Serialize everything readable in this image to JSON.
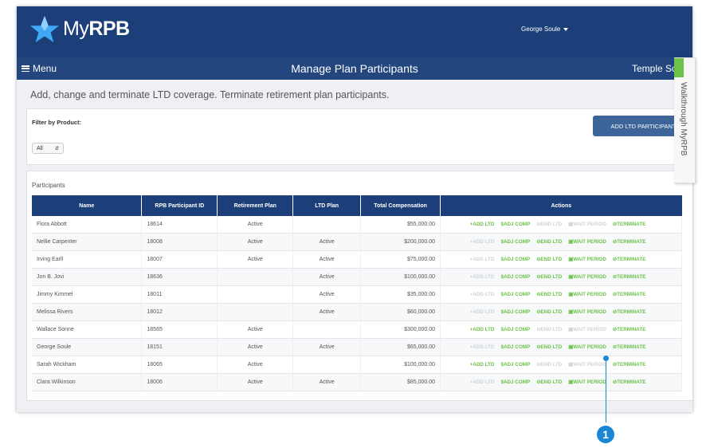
{
  "header": {
    "logo_prefix": "My",
    "logo_bold": "RPB",
    "user_name": "George Soule"
  },
  "navbar": {
    "menu_label": "Menu",
    "title": "Manage Plan Participants",
    "org_name": "Temple Solom"
  },
  "walkthrough_tab": "Walkthrough MyRPB",
  "description": "Add, change and terminate LTD coverage. Terminate retirement plan participants.",
  "filter": {
    "label": "Filter by Product:",
    "selected": "All"
  },
  "add_button": "ADD LTD PARTICIPANT",
  "participants": {
    "title": "Participants",
    "columns": [
      "Name",
      "RPB Participant ID",
      "Retirement Plan",
      "LTD Plan",
      "Total Compensation",
      "Actions"
    ],
    "action_labels": [
      "+ADD LTD",
      "$ADJ COMP",
      "⊖END LTD",
      "▣WAIT PERIOD",
      "⊘TERMINATE"
    ],
    "rows": [
      {
        "name": "Flora Abbott",
        "id": "18614",
        "retirement": "Active",
        "ltd": "",
        "comp": "$55,000.00",
        "enabled": [
          true,
          true,
          false,
          false,
          true
        ]
      },
      {
        "name": "Nellie Carpenter",
        "id": "18008",
        "retirement": "Active",
        "ltd": "Active",
        "comp": "$200,000.00",
        "enabled": [
          false,
          true,
          true,
          true,
          true
        ]
      },
      {
        "name": "Irving Earll",
        "id": "18007",
        "retirement": "Active",
        "ltd": "Active",
        "comp": "$75,000.00",
        "enabled": [
          false,
          true,
          true,
          true,
          true
        ]
      },
      {
        "name": "Jon B. Jovi",
        "id": "18636",
        "retirement": "",
        "ltd": "Active",
        "comp": "$100,000.00",
        "enabled": [
          false,
          true,
          true,
          true,
          true
        ]
      },
      {
        "name": "Jimmy Kimmel",
        "id": "18011",
        "retirement": "",
        "ltd": "Active",
        "comp": "$35,000.00",
        "enabled": [
          false,
          true,
          true,
          true,
          true
        ]
      },
      {
        "name": "Melissa Rivers",
        "id": "18012",
        "retirement": "",
        "ltd": "Active",
        "comp": "$60,000.00",
        "enabled": [
          false,
          true,
          true,
          true,
          true
        ]
      },
      {
        "name": "Wallace Sonne",
        "id": "18565",
        "retirement": "Active",
        "ltd": "",
        "comp": "$300,000.00",
        "enabled": [
          true,
          true,
          false,
          false,
          true
        ]
      },
      {
        "name": "George Soule",
        "id": "18151",
        "retirement": "Active",
        "ltd": "Active",
        "comp": "$65,000.00",
        "enabled": [
          false,
          true,
          true,
          true,
          true
        ]
      },
      {
        "name": "Sarah Wickham",
        "id": "18065",
        "retirement": "Active",
        "ltd": "",
        "comp": "$100,000.00",
        "enabled": [
          true,
          true,
          false,
          false,
          true
        ]
      },
      {
        "name": "Clara Wilkinson",
        "id": "18006",
        "retirement": "Active",
        "ltd": "Active",
        "comp": "$85,000.00",
        "enabled": [
          false,
          true,
          true,
          true,
          true
        ]
      }
    ]
  },
  "callout": "1",
  "colors": {
    "header_blue": "#1c3f7a",
    "button_blue": "#3d6599",
    "action_green": "#6cc24a",
    "callout_blue": "#1a86d6"
  }
}
